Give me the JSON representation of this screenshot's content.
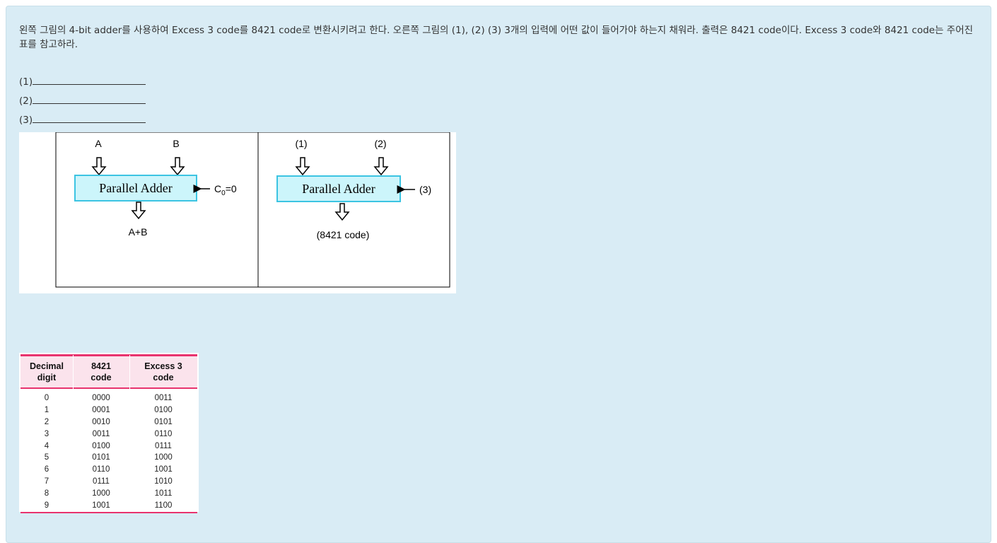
{
  "question": {
    "text": "왼쪽 그림의 4-bit adder를 사용하여 Excess 3 code를 8421 code로 변환시키려고 한다.  오른쪽 그림의 (1), (2) (3) 3개의 입력에 어떤 값이 들어가야 하는지 채워라. 출력은 8421 code이다. Excess 3 code와 8421 code는 주어진 표를 참고하라."
  },
  "answers": [
    {
      "label": "(1)"
    },
    {
      "label": "(2)"
    },
    {
      "label": "(3)"
    }
  ],
  "figure": {
    "left": {
      "input_a": "A",
      "input_b": "B",
      "box_label": "Parallel Adder",
      "carry_label": "C",
      "carry_sub": "0",
      "carry_value": "=0",
      "output_label": "A+B"
    },
    "right": {
      "input_1": "(1)",
      "input_2": "(2)",
      "box_label": "Parallel Adder",
      "carry_label": "(3)",
      "output_label": "(8421 code)"
    },
    "colors": {
      "box_fill": "#ccf5fb",
      "box_stroke": "#3cc4e2"
    }
  },
  "table": {
    "headers": [
      [
        "Decimal",
        "digit"
      ],
      [
        "8421",
        "code"
      ],
      [
        "Excess 3",
        "code"
      ]
    ],
    "rows": [
      [
        "0",
        "0000",
        "0011"
      ],
      [
        "1",
        "0001",
        "0100"
      ],
      [
        "2",
        "0010",
        "0101"
      ],
      [
        "3",
        "0011",
        "0110"
      ],
      [
        "4",
        "0100",
        "0111"
      ],
      [
        "5",
        "0101",
        "1000"
      ],
      [
        "6",
        "0110",
        "1001"
      ],
      [
        "7",
        "0111",
        "1010"
      ],
      [
        "8",
        "1000",
        "1011"
      ],
      [
        "9",
        "1001",
        "1100"
      ]
    ],
    "colors": {
      "accent": "#e8336e",
      "header_bg": "#fbe3ec"
    }
  }
}
